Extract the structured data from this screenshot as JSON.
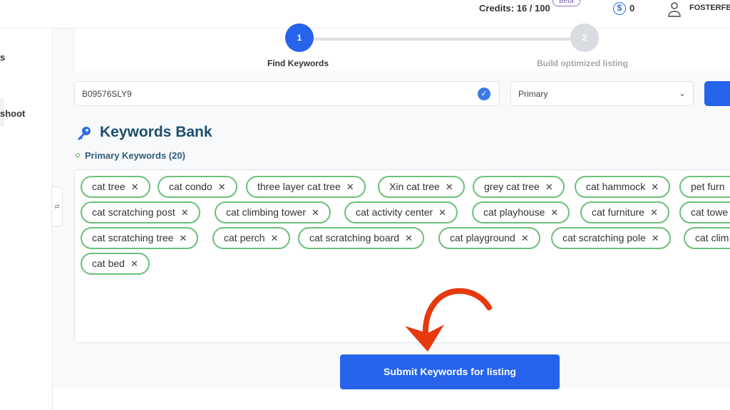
{
  "header": {
    "credits": "Credits: 16 / 100",
    "beta": "Beta",
    "balance": "0",
    "currency_icon": "$",
    "username": "FOSTERFB"
  },
  "sidebar": {
    "items": [
      {
        "label": "s"
      },
      {
        "label": "shoot"
      }
    ]
  },
  "stepper": {
    "steps": [
      {
        "number": "1",
        "label": "Find Keywords",
        "active": true
      },
      {
        "number": "2",
        "label": "Build optimized listing",
        "active": false
      }
    ]
  },
  "search": {
    "value": "B09576SLY9",
    "select_value": "Primary"
  },
  "keywords_bank": {
    "title": "Keywords Bank",
    "subtitle": "Primary Keywords (20)",
    "chips": [
      "cat tree",
      "cat condo",
      "three layer cat tree",
      "Xin cat tree",
      "grey cat tree",
      "cat hammock",
      "pet furn",
      "cat scratching post",
      "cat climbing tower",
      "cat activity center",
      "cat playhouse",
      "cat furniture",
      "cat towe",
      "cat scratching tree",
      "cat perch",
      "cat scratching board",
      "cat playground",
      "cat scratching pole",
      "cat clim",
      "cat bed"
    ],
    "remove_glyph": "✕"
  },
  "submit_label": "Submit Keywords for listing",
  "colors": {
    "primary": "#2563eb",
    "chip_border": "#6cc07a",
    "arrow": "#e8380d",
    "title": "#1d4e6e"
  }
}
